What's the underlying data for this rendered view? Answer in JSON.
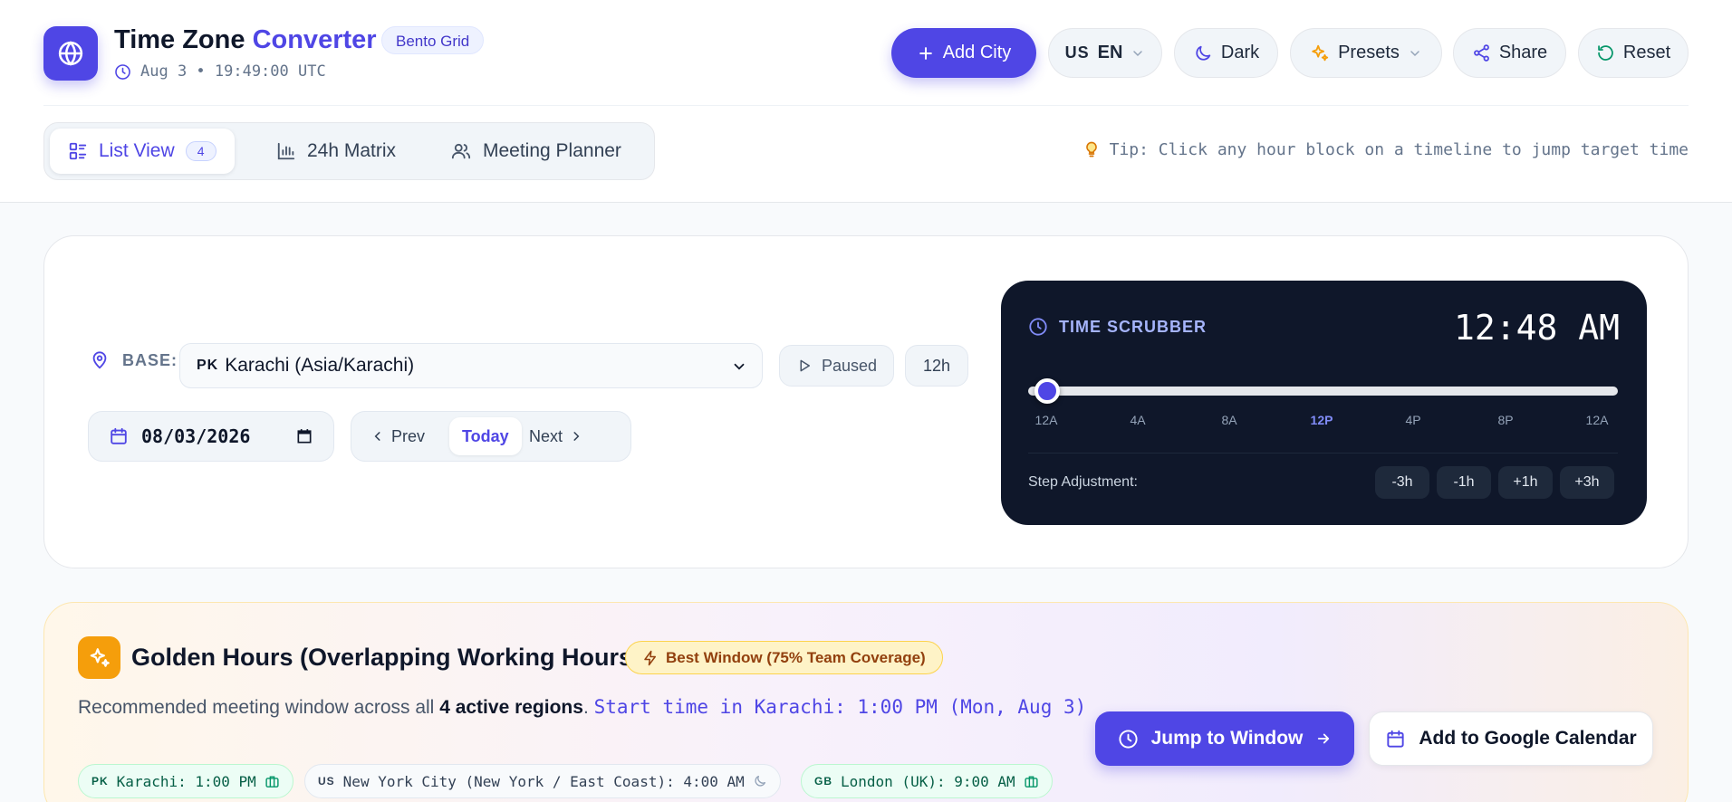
{
  "header": {
    "title_main": "Time Zone",
    "title_accent": "Converter",
    "badge": "Bento Grid",
    "subtitle": "Aug 3 • 19:49:00 UTC",
    "buttons": {
      "add_city": "Add City",
      "lang_flag": "US",
      "lang": "EN",
      "dark": "Dark",
      "presets": "Presets",
      "share": "Share",
      "reset": "Reset"
    }
  },
  "tabs": [
    {
      "label": "List View",
      "count": "4",
      "active": true
    },
    {
      "label": "24h Matrix"
    },
    {
      "label": "Meeting Planner"
    }
  ],
  "tip": "Tip: Click any hour block on a timeline to jump target time",
  "controls": {
    "base_label": "BASE:",
    "base_flag": "PK",
    "base_value": "Karachi (Asia/Karachi)",
    "paused": "Paused",
    "format": "12h",
    "date": "08/03/2026",
    "prev": "Prev",
    "today": "Today",
    "next": "Next"
  },
  "scrubber": {
    "heading": "TIME SCRUBBER",
    "time": "12:48 AM",
    "value_fraction": 0.033,
    "ticks": [
      "12A",
      "4A",
      "8A",
      "12P",
      "4P",
      "8P",
      "12A"
    ],
    "step_label": "Step Adjustment:",
    "steps": [
      "-3h",
      "-1h",
      "+1h",
      "+3h"
    ]
  },
  "golden": {
    "title": "Golden Hours (Overlapping Working Hours)",
    "badge": "Best Window (75% Team Coverage)",
    "desc_prefix": "Recommended meeting window across all ",
    "desc_bold": "4 active regions",
    "desc_suffix": ". ",
    "start_text": "Start time in Karachi: 1:00 PM (Mon, Aug 3)",
    "chips": [
      {
        "flag": "PK",
        "text": "Karachi: 1:00 PM",
        "status": "work"
      },
      {
        "flag": "US",
        "text": "New York City (New York / East Coast): 4:00 AM",
        "status": "off"
      },
      {
        "flag": "GB",
        "text": "London (UK): 9:00 AM",
        "status": "work"
      }
    ],
    "jump": "Jump to Window",
    "gcal": "Add to Google Calendar"
  },
  "colors": {
    "accent": "#4f46e5",
    "scrubber_bg": "#0f172a",
    "golden_icon": "#f59e0b"
  }
}
